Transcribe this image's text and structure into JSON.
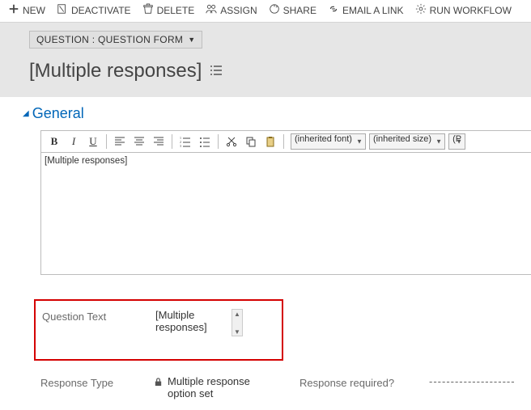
{
  "commands": {
    "new": "NEW",
    "deactivate": "DEACTIVATE",
    "delete": "DELETE",
    "assign": "ASSIGN",
    "share": "SHARE",
    "email": "EMAIL A LINK",
    "workflow": "RUN WORKFLOW"
  },
  "form_selector": "QUESTION : QUESTION FORM",
  "record_title": "[Multiple responses]",
  "section": {
    "general_label": "General"
  },
  "editor": {
    "text": "[Multiple responses]",
    "font_label": "(inherited font)",
    "size_label": "(inherited size)",
    "partial_label": "(P"
  },
  "fields": {
    "question_text": {
      "label": "Question Text",
      "value": "[Multiple responses]"
    },
    "response_type": {
      "label": "Response Type",
      "value": "Multiple response option set"
    },
    "response_required": {
      "label": "Response required?",
      "value": "--------------------"
    }
  }
}
